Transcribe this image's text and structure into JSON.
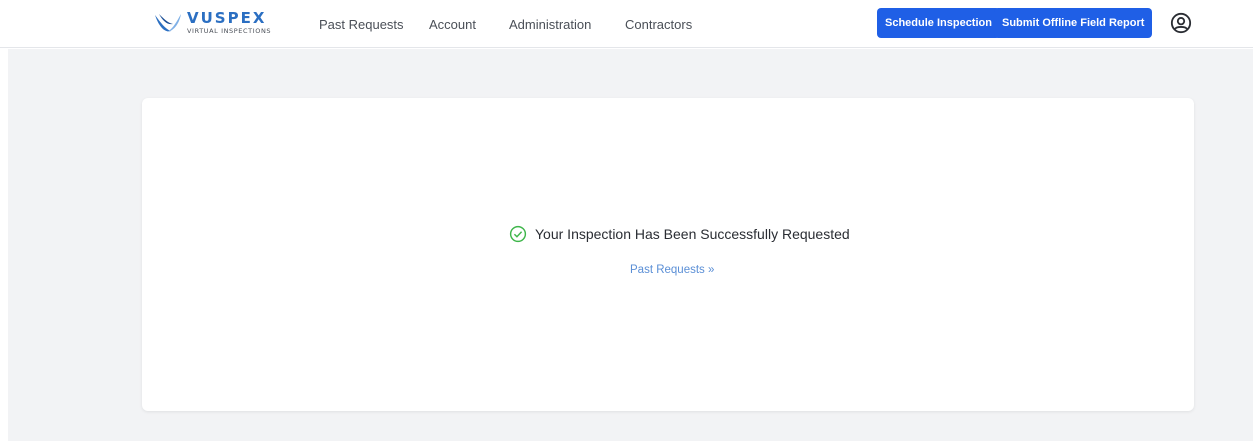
{
  "header": {
    "logo": {
      "word": "VUSPEX",
      "tagline": "VIRTUAL INSPECTIONS"
    },
    "nav": [
      {
        "label": "Past Requests"
      },
      {
        "label": "Account"
      },
      {
        "label": "Administration"
      },
      {
        "label": "Contractors"
      }
    ],
    "buttons": {
      "schedule": "Schedule Inspection",
      "submit_report": "Submit Offline Field Report"
    },
    "user_icon": "user-circle-icon"
  },
  "main": {
    "success_message": "Your Inspection Has Been Successfully Requested",
    "success_icon": "check-circle-icon",
    "link_label": "Past Requests »"
  },
  "colors": {
    "primary_button": "#1f5fe6",
    "success": "#3fb64b",
    "link": "#5b8fd6",
    "background": "#f2f3f5"
  }
}
